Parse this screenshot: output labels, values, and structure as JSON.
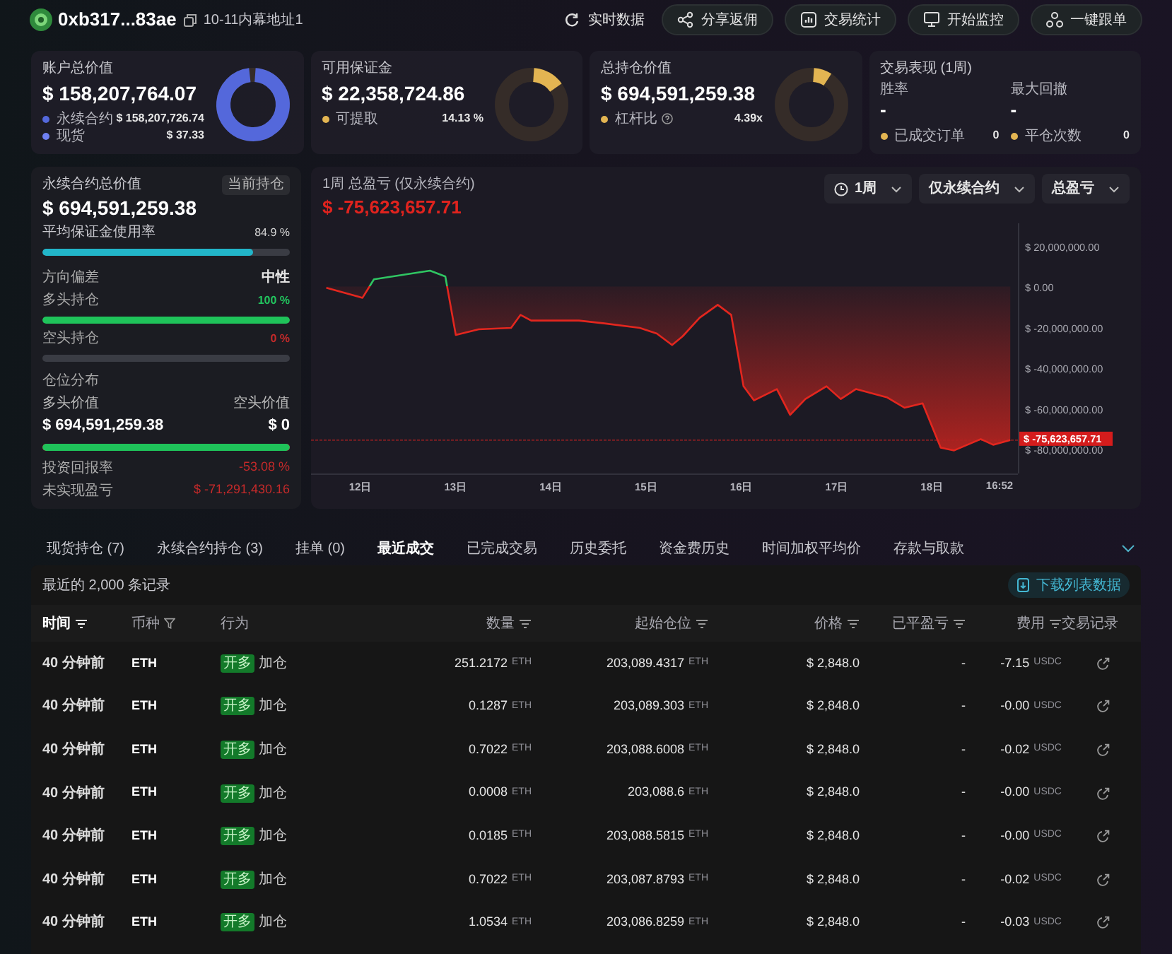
{
  "header": {
    "address": "0xb317...83ae",
    "label": "10-11内幕地址1",
    "actions": [
      {
        "kind": "plain",
        "label": "实时数据"
      },
      {
        "kind": "pill",
        "label": "分享返佣"
      },
      {
        "kind": "pill",
        "label": "交易统计"
      },
      {
        "kind": "pill",
        "label": "开始监控"
      },
      {
        "kind": "pill",
        "label": "一键跟单"
      }
    ]
  },
  "summary_cards": [
    {
      "kind": "donut",
      "title": "账户总价值",
      "value": "$ 158,207,764.07",
      "level": 1.0,
      "color": "#5468db",
      "legend": [
        {
          "label": "永续合约",
          "value": "$ 158,207,726.74",
          "color": "#5468db"
        },
        {
          "label": "现货",
          "value": "$ 37.33",
          "color": "#6f80f2"
        }
      ]
    },
    {
      "kind": "donut",
      "title": "可用保证金",
      "value": "$ 22,358,724.86",
      "level": 0.1413,
      "color": "#e3b552",
      "legend": [
        {
          "label": "可提取",
          "value": "14.13 %",
          "color": "#e3b552"
        }
      ]
    },
    {
      "kind": "donut",
      "title": "总持仓价值",
      "value": "$ 694,591,259.38",
      "level": 0.08,
      "color": "#e3b552",
      "legend": [
        {
          "label": "杠杆比",
          "help": true,
          "value": "4.39x",
          "color": "#e3b552"
        }
      ]
    },
    {
      "kind": "stats",
      "title": "交易表现 (1周)",
      "stats": [
        {
          "label": "胜率",
          "value": "-"
        },
        {
          "label": "最大回撤",
          "value": "-"
        }
      ],
      "legend": [
        {
          "label": "已成交订单",
          "value": "0",
          "color": "#e3b552"
        },
        {
          "label": "平仓次数",
          "value": "0",
          "color": "#e3b552"
        }
      ]
    }
  ],
  "perp_panel": {
    "title": "永续合约总价值",
    "badge": "当前持仓",
    "value": "$ 694,591,259.38",
    "margin": {
      "label": "平均保证金使用率",
      "value": "84.9 %",
      "level": 0.849
    },
    "direction": {
      "label": "方向偏差",
      "value": "中性"
    },
    "long": {
      "label": "多头持仓",
      "value": "100 %",
      "level": 1.0
    },
    "short": {
      "label": "空头持仓",
      "value": "0 %",
      "level": 0.0
    },
    "distribution": {
      "label": "仓位分布",
      "long_label": "多头价值",
      "short_label": "空头价值",
      "long_value": "$ 694,591,259.38",
      "short_value": "$ 0",
      "level": 1.0
    },
    "roi": {
      "label": "投资回报率",
      "value": "-53.08 %"
    },
    "unrealized": {
      "label": "未实现盈亏",
      "value": "$ -71,291,430.16"
    }
  },
  "pnl_panel": {
    "title": "1周 总盈亏 (仅永续合约)",
    "value": "$ -75,623,657.71",
    "last_time": "16:52",
    "filters": [
      {
        "kind": "period",
        "label": "1周"
      },
      {
        "kind": "plain",
        "label": "仅永续合约"
      },
      {
        "kind": "plain",
        "label": "总盈亏"
      }
    ],
    "chart_data": {
      "type": "area",
      "x": [
        11.64,
        12.02,
        12.14,
        12.73,
        12.89,
        13.0,
        13.24,
        13.58,
        13.68,
        13.79,
        14.29,
        14.56,
        14.93,
        15.11,
        15.27,
        15.38,
        15.56,
        15.75,
        15.89,
        16.02,
        16.13,
        16.37,
        16.51,
        16.67,
        16.89,
        17.04,
        17.2,
        17.53,
        17.71,
        17.9,
        18.09,
        18.23,
        18.51,
        18.64,
        18.82
      ],
      "series": [
        {
          "color": "#e3261e",
          "values": [
            -700000,
            -5600000,
            3500000,
            7700000,
            4900000,
            -23900000,
            -21100000,
            -20400000,
            -14000000,
            -16800000,
            -16800000,
            -18200000,
            -20400000,
            -23200000,
            -28800000,
            -24600000,
            -15400000,
            -9100000,
            -14000000,
            -49100000,
            -56100000,
            -50500000,
            -63200000,
            -55400000,
            -49100000,
            -55400000,
            -50500000,
            -54700000,
            -59700000,
            -57500000,
            -79300000,
            -80700000,
            -75100000,
            -77900000,
            -75600000
          ]
        }
      ],
      "xlim": [
        11.48,
        18.9
      ],
      "ylim": [
        -92000000,
        31000000
      ],
      "xticks": [
        {
          "value": 12,
          "label": "12日"
        },
        {
          "value": 13,
          "label": "13日"
        },
        {
          "value": 14,
          "label": "14日"
        },
        {
          "value": 15,
          "label": "15日"
        },
        {
          "value": 16,
          "label": "16日"
        },
        {
          "value": 17,
          "label": "17日"
        },
        {
          "value": 18,
          "label": "18日"
        }
      ],
      "yticks": [
        {
          "value": 20000000,
          "label": "$ 20,000,000.00"
        },
        {
          "value": 0,
          "label": "$ 0.00"
        },
        {
          "value": -20000000,
          "label": "$ -20,000,000.00"
        },
        {
          "value": -40000000,
          "label": "$ -40,000,000.00"
        },
        {
          "value": -60000000,
          "label": "$ -60,000,000.00"
        },
        {
          "value": -80000000,
          "label": "$ -80,000,000.00"
        }
      ],
      "ref_lines": [
        {
          "axis": "y",
          "value": -75623657.71,
          "label": "$ -75,623,657.71"
        }
      ]
    }
  },
  "tabs": [
    {
      "label": "现货持仓 (7)",
      "selected": false
    },
    {
      "label": "永续合约持仓 (3)",
      "selected": false
    },
    {
      "label": "挂单 (0)",
      "selected": false
    },
    {
      "label": "最近成交",
      "selected": true
    },
    {
      "label": "已完成交易",
      "selected": false
    },
    {
      "label": "历史委托",
      "selected": false
    },
    {
      "label": "资金费历史",
      "selected": false
    },
    {
      "label": "时间加权平均价",
      "selected": false
    },
    {
      "label": "存款与取款",
      "selected": false
    }
  ],
  "table": {
    "caption": "最近的 2,000 条记录",
    "download": "下载列表数据",
    "columns": [
      {
        "label": "时间",
        "kind": "sort",
        "active": true
      },
      {
        "label": "币种",
        "kind": "filter",
        "active": false
      },
      {
        "label": "行为",
        "kind": "none",
        "active": false
      },
      {
        "label": "数量",
        "kind": "sort",
        "active": false
      },
      {
        "label": "起始仓位",
        "kind": "sort",
        "active": false
      },
      {
        "label": "价格",
        "kind": "sort",
        "active": false
      },
      {
        "label": "已平盈亏",
        "kind": "sort",
        "active": false
      },
      {
        "label": "费用",
        "kind": "sort",
        "active": false
      },
      {
        "label": "交易记录",
        "kind": "none",
        "active": false
      }
    ],
    "rows": [
      {
        "time": "40 分钟前",
        "coin": "ETH",
        "side": "开多",
        "action": "加仓",
        "qty": "251.2172",
        "qty_unit": "ETH",
        "start": "203,089.4317",
        "start_unit": "ETH",
        "price": "$ 2,848.0",
        "pnl": "-",
        "fee": "-7.15",
        "fee_unit": "USDC"
      },
      {
        "time": "40 分钟前",
        "coin": "ETH",
        "side": "开多",
        "action": "加仓",
        "qty": "0.1287",
        "qty_unit": "ETH",
        "start": "203,089.303",
        "start_unit": "ETH",
        "price": "$ 2,848.0",
        "pnl": "-",
        "fee": "-0.00",
        "fee_unit": "USDC"
      },
      {
        "time": "40 分钟前",
        "coin": "ETH",
        "side": "开多",
        "action": "加仓",
        "qty": "0.7022",
        "qty_unit": "ETH",
        "start": "203,088.6008",
        "start_unit": "ETH",
        "price": "$ 2,848.0",
        "pnl": "-",
        "fee": "-0.02",
        "fee_unit": "USDC"
      },
      {
        "time": "40 分钟前",
        "coin": "ETH",
        "side": "开多",
        "action": "加仓",
        "qty": "0.0008",
        "qty_unit": "ETH",
        "start": "203,088.6",
        "start_unit": "ETH",
        "price": "$ 2,848.0",
        "pnl": "-",
        "fee": "-0.00",
        "fee_unit": "USDC"
      },
      {
        "time": "40 分钟前",
        "coin": "ETH",
        "side": "开多",
        "action": "加仓",
        "qty": "0.0185",
        "qty_unit": "ETH",
        "start": "203,088.5815",
        "start_unit": "ETH",
        "price": "$ 2,848.0",
        "pnl": "-",
        "fee": "-0.00",
        "fee_unit": "USDC"
      },
      {
        "time": "40 分钟前",
        "coin": "ETH",
        "side": "开多",
        "action": "加仓",
        "qty": "0.7022",
        "qty_unit": "ETH",
        "start": "203,087.8793",
        "start_unit": "ETH",
        "price": "$ 2,848.0",
        "pnl": "-",
        "fee": "-0.02",
        "fee_unit": "USDC"
      },
      {
        "time": "40 分钟前",
        "coin": "ETH",
        "side": "开多",
        "action": "加仓",
        "qty": "1.0534",
        "qty_unit": "ETH",
        "start": "203,086.8259",
        "start_unit": "ETH",
        "price": "$ 2,848.0",
        "pnl": "-",
        "fee": "-0.03",
        "fee_unit": "USDC"
      }
    ]
  }
}
